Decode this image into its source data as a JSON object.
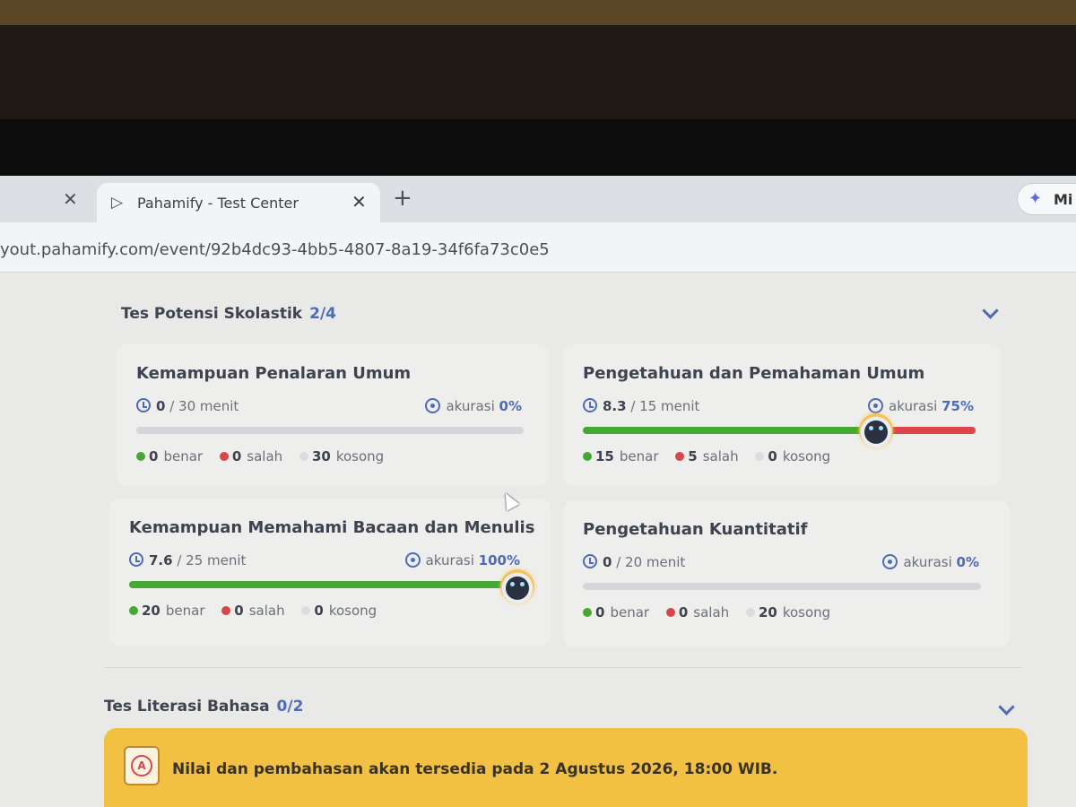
{
  "browser": {
    "tab_title": "Pahamify - Test Center",
    "url": "yout.pahamify.com/event/92b4dc93-4bb5-4807-8a19-34f6fa73c0e5",
    "gemini_label": "Mi"
  },
  "sections": [
    {
      "title": "Tes Potensi Skolastik",
      "count": "2/4",
      "cards": [
        {
          "title": "Kemampuan Penalaran Umum",
          "time_spent": "0",
          "time_total": " / 30 menit",
          "accuracy_label": "akurasi",
          "accuracy": "0%",
          "correct": "0",
          "correct_label": "benar",
          "wrong": "0",
          "wrong_label": "salah",
          "empty": "30",
          "empty_label": "kosong",
          "correct_fraction": 0.0,
          "wrong_fraction": 0.0
        },
        {
          "title": "Pengetahuan dan Pemahaman Umum",
          "time_spent": "8.3",
          "time_total": " / 15 menit",
          "accuracy_label": "akurasi",
          "accuracy": "75%",
          "correct": "15",
          "correct_label": "benar",
          "wrong": "5",
          "wrong_label": "salah",
          "empty": "0",
          "empty_label": "kosong",
          "correct_fraction": 0.75,
          "wrong_fraction": 0.25
        },
        {
          "title": "Kemampuan Memahami Bacaan dan Menulis",
          "time_spent": "7.6",
          "time_total": " / 25 menit",
          "accuracy_label": "akurasi",
          "accuracy": "100%",
          "correct": "20",
          "correct_label": "benar",
          "wrong": "0",
          "wrong_label": "salah",
          "empty": "0",
          "empty_label": "kosong",
          "correct_fraction": 1.0,
          "wrong_fraction": 0.0
        },
        {
          "title": "Pengetahuan Kuantitatif",
          "time_spent": "0",
          "time_total": " / 20 menit",
          "accuracy_label": "akurasi",
          "accuracy": "0%",
          "correct": "0",
          "correct_label": "benar",
          "wrong": "0",
          "wrong_label": "salah",
          "empty": "20",
          "empty_label": "kosong",
          "correct_fraction": 0.0,
          "wrong_fraction": 0.0
        }
      ]
    },
    {
      "title": "Tes Literasi Bahasa",
      "count": "0/2"
    }
  ],
  "notice": {
    "text": "Nilai dan pembahasan akan tersedia pada 2 Agustus 2026, 18:00 WIB."
  },
  "icons": {
    "tab": "pahamify-logo-icon",
    "clock": "stopwatch-icon",
    "accuracy": "target-icon",
    "mascot": "cat-mascot-icon",
    "gemini": "sparkle-icon"
  },
  "colors": {
    "accent": "#4e6bb8",
    "correct": "#44a832",
    "wrong": "#d9454a",
    "empty": "#d9dce0",
    "banner": "#f2c043"
  }
}
